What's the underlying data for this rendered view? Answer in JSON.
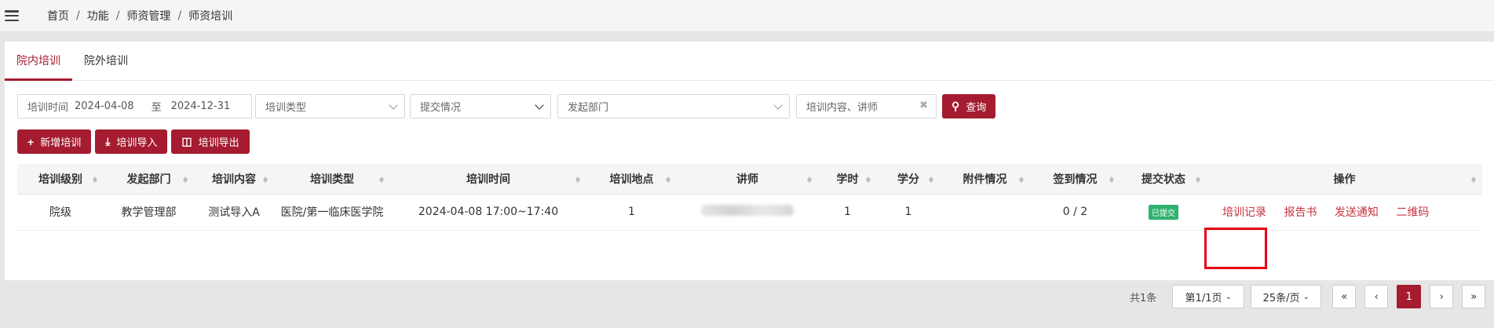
{
  "breadcrumb": [
    "首页",
    "功能",
    "师资管理",
    "师资培训"
  ],
  "breadcrumb_sep": "/",
  "tabs": [
    {
      "label": "院内培训",
      "active": true
    },
    {
      "label": "院外培训",
      "active": false
    }
  ],
  "filters": {
    "date_label": "培训时间",
    "date_from": "2024-04-08",
    "date_to_sep": "至",
    "date_to": "2024-12-31",
    "type_placeholder": "培训类型",
    "submit_selected": "提交情况",
    "dept_placeholder": "发起部门",
    "keyword_placeholder": "培训内容、讲师",
    "search_label": "查询"
  },
  "actions": {
    "add_label": "新增培训",
    "import_label": "培训导入",
    "export_label": "培训导出"
  },
  "table": {
    "columns": [
      "培训级别",
      "发起部门",
      "培训内容",
      "培训类型",
      "培训时间",
      "培训地点",
      "讲师",
      "学时",
      "学分",
      "附件情况",
      "签到情况",
      "提交状态",
      "操作"
    ],
    "rows": [
      {
        "level": "院级",
        "dept": "教学管理部",
        "content": "测试导入A",
        "type": "医院/第一临床医学院",
        "time": "2024-04-08 17:00~17:40",
        "place": "1",
        "hours": "1",
        "credits": "1",
        "attachments": "",
        "signin": "0 / 2",
        "status": "已提交",
        "ops": [
          "培训记录",
          "报告书",
          "发送通知",
          "二维码"
        ]
      }
    ]
  },
  "pagination": {
    "total": "共1条",
    "page_select": "第1/1页",
    "size_select": "25条/页",
    "first": "«",
    "prev": "‹",
    "current": "1",
    "next": "›",
    "last": "»"
  },
  "colors": {
    "accent": "#a51c30",
    "badge": "#2fb36f",
    "highlight": "#e60012"
  }
}
